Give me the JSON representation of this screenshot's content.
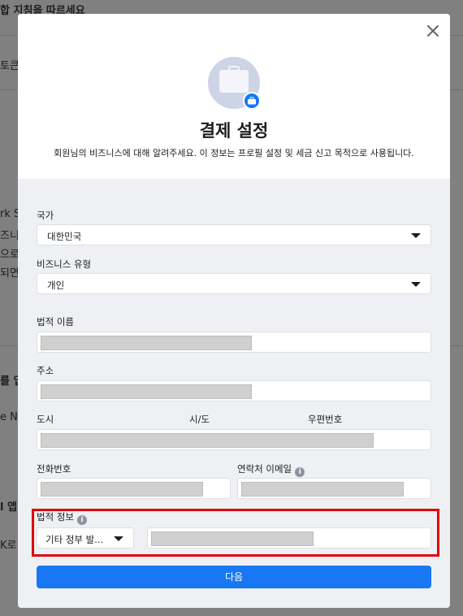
{
  "background": {
    "fragments": [
      "합 지침을 따르세요",
      "토큰",
      "rk S",
      "즈니",
      "으로",
      "되면",
      "를 입",
      "e N",
      "l 앱",
      "K로"
    ]
  },
  "modal": {
    "close_icon": "close-icon",
    "hero_icon": "briefcase-icon",
    "title": "결제 설정",
    "subtitle": "회원님의 비즈니스에 대해 알려주세요. 이 정보는 프로필 설정 및 세금 신고 목적으로 사용됩니다.",
    "country": {
      "label": "국가",
      "value": "대한민국"
    },
    "business_type": {
      "label": "비즈니스 유형",
      "value": "개인"
    },
    "legal_name": {
      "label": "법적 이름",
      "value": ""
    },
    "address": {
      "label": "주소",
      "value": ""
    },
    "city": {
      "label": "도시",
      "value": ""
    },
    "state": {
      "label": "시/도",
      "value": ""
    },
    "postal_code": {
      "label": "우편번호",
      "value": ""
    },
    "phone": {
      "label": "전화번호",
      "value": ""
    },
    "contact_email": {
      "label": "연락처 이메일",
      "value": ""
    },
    "legal_info": {
      "label": "법적 정보",
      "select_value": "기타 정부 발...",
      "value": ""
    },
    "info_glyph": "i",
    "next_button": "다음"
  },
  "colors": {
    "primary": "#1877f2",
    "highlight": "#e0040b",
    "redaction": "#d0d0d0"
  }
}
